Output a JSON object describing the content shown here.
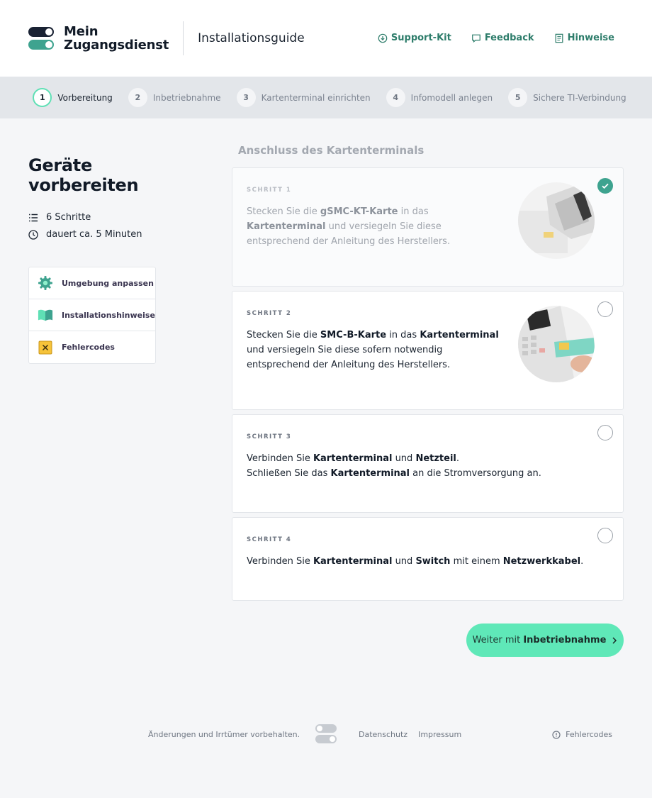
{
  "header": {
    "logo_line1": "Mein",
    "logo_line2": "Zugangsdienst",
    "title": "Installationsguide",
    "links": [
      {
        "label": "Support-Kit",
        "icon": "download-circle-icon"
      },
      {
        "label": "Feedback",
        "icon": "speech-bubble-icon"
      },
      {
        "label": "Hinweise",
        "icon": "document-icon"
      }
    ]
  },
  "stepper": [
    {
      "num": "1",
      "label": "Vorbereitung",
      "active": true
    },
    {
      "num": "2",
      "label": "Inbetriebnahme"
    },
    {
      "num": "3",
      "label": "Kartenterminal einrichten"
    },
    {
      "num": "4",
      "label": "Infomodell anlegen"
    },
    {
      "num": "5",
      "label": "Sichere TI-Verbindung"
    }
  ],
  "sidebar": {
    "title": "Geräte vorbereiten",
    "steps_count": "6 Schritte",
    "duration": "dauert ca. 5 Minuten",
    "menu": [
      {
        "label": "Umgebung anpassen",
        "icon": "gear-icon"
      },
      {
        "label": "Installationshinweise",
        "icon": "book-icon"
      },
      {
        "label": "Fehlercodes",
        "icon": "error-x-icon"
      }
    ]
  },
  "section_title": "Anschluss des Kartenterminals",
  "cards": [
    {
      "step": "SCHRITT 1",
      "done": true,
      "p1": "Stecken Sie die ",
      "b1": "gSMC-KT-Karte",
      "p2": " in das ",
      "b2": "Kartenterminal",
      "p3": " und versiegeln Sie diese entsprechend der Anleitung des Herstellers."
    },
    {
      "step": "SCHRITT 2",
      "p1": "Stecken Sie die ",
      "b1": "SMC-B-Karte",
      "p2": " in das ",
      "b2": "Kartenterminal",
      "p3": " und versiegeln Sie diese sofern notwendig entsprechend der Anleitung des Herstellers."
    },
    {
      "step": "SCHRITT 3",
      "p1": "Verbinden Sie ",
      "b1": "Kartenterminal",
      "p2": " und ",
      "b2": "Netzteil",
      "p3": ".",
      "p4": "Schließen Sie das ",
      "b3": "Kartenterminal",
      "p5": " an die Stromversorgung an."
    },
    {
      "step": "SCHRITT 4",
      "p1": "Verbinden Sie ",
      "b1": "Kartenterminal",
      "p2": " und ",
      "b2": "Switch",
      "p3": " mit einem ",
      "b3": "Netzwerkkabel",
      "p4": "."
    }
  ],
  "cta": {
    "prefix": "Weiter mit ",
    "bold": "Inbetriebnahme",
    "icon": "chevron-right-icon"
  },
  "footer": {
    "disclaimer": "Änderungen und Irrtümer vorbehalten.",
    "links": [
      "Datenschutz",
      "Impressum"
    ],
    "error_codes": "Fehlercodes"
  },
  "colors": {
    "accent": "#3ea38f",
    "cta": "#5fe8b8",
    "link": "#2e7d6b"
  }
}
